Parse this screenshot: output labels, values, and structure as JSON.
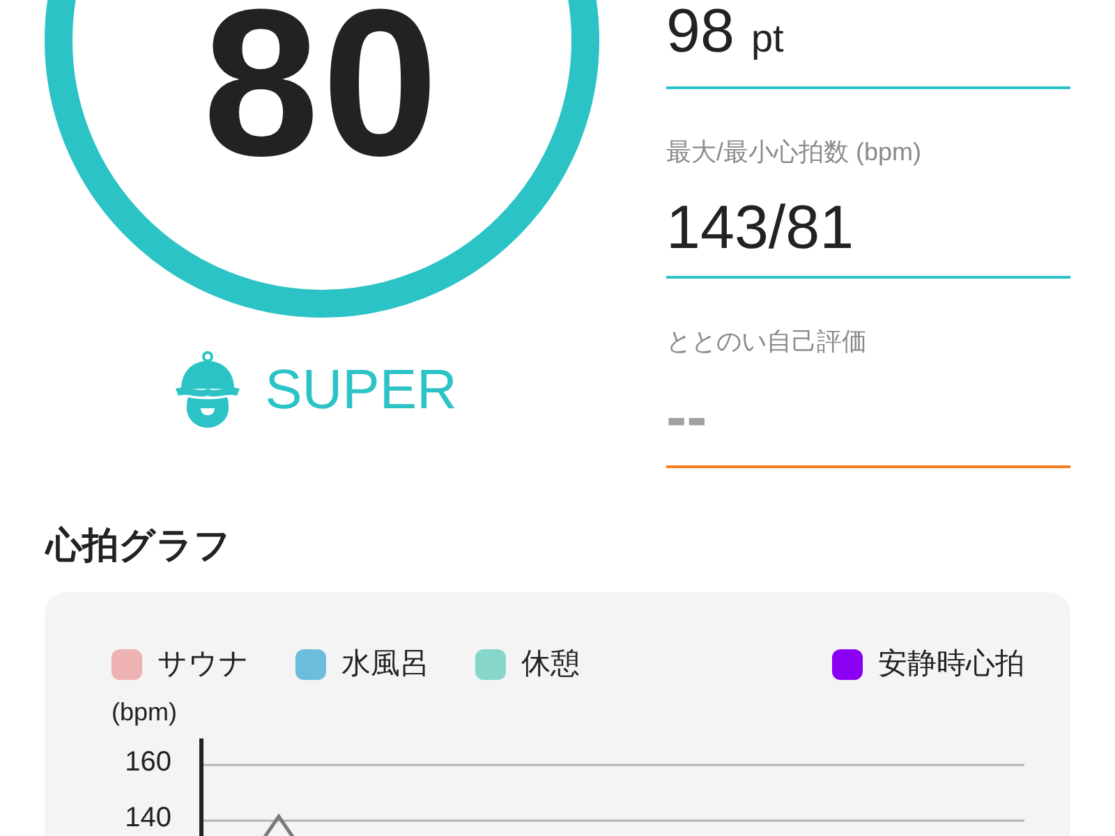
{
  "score": {
    "value": "80",
    "rank": "SUPER"
  },
  "metrics": [
    {
      "kind": "stat",
      "value": "98",
      "unit": "pt"
    },
    {
      "kind": "stat",
      "label": "最大/最小心拍数 (bpm)",
      "value": "143/81"
    },
    {
      "kind": "rating",
      "label": "ととのい自己評価",
      "value": "--"
    }
  ],
  "heart_rate_graph": {
    "title": "心拍グラフ",
    "legend": {
      "zones": [
        {
          "label": "サウナ",
          "color": "#eeb2b2"
        },
        {
          "label": "水風呂",
          "color": "#6cbddc"
        },
        {
          "label": "休憩",
          "color": "#86d6cc"
        }
      ],
      "lines": [
        {
          "label": "安静時心拍",
          "color": "#8b00f5"
        }
      ]
    },
    "axis": {
      "unit": "(bpm)",
      "ticks": [
        "160",
        "140"
      ]
    }
  }
}
